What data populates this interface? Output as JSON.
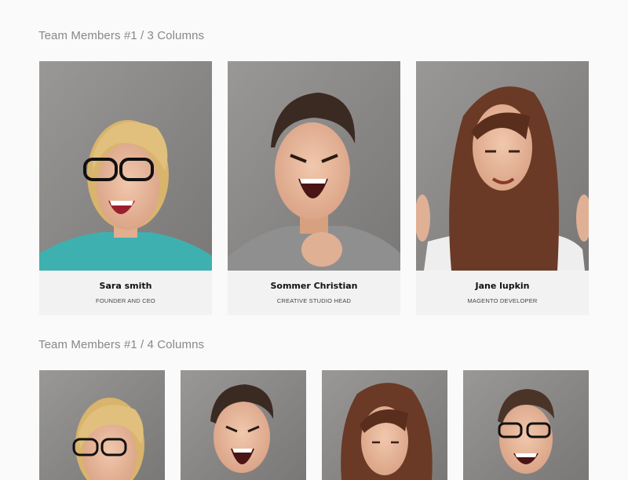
{
  "sections": [
    {
      "title": "Team Members #1 / 3 Columns",
      "members": [
        {
          "name": "Sara smith",
          "role": "FOUNDER AND CEO"
        },
        {
          "name": "Sommer Christian",
          "role": "CREATIVE STUDIO HEAD"
        },
        {
          "name": "Jane lupkin",
          "role": "MAGENTO DEVELOPER"
        }
      ]
    },
    {
      "title": "Team Members #1 / 4 Columns"
    }
  ],
  "colors": {
    "background": "#fafafa",
    "card": "#f2f2f2",
    "title": "#888888",
    "photo_backdrop": "#8a8a8a"
  }
}
